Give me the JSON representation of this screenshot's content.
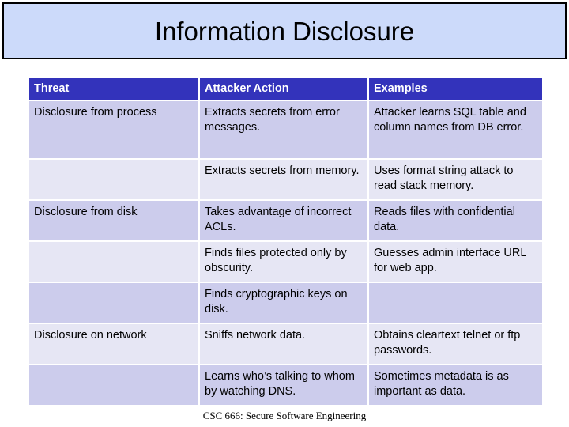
{
  "slide": {
    "title": "Information Disclosure",
    "footer": "CSC 666: Secure Software Engineering"
  },
  "colors": {
    "title_banner_bg": "#ccdafa",
    "title_banner_border": "#000000",
    "table_header_bg": "#3333bb",
    "table_header_text": "#ffffff",
    "row_shade_dark": "#ccccec",
    "row_shade_light": "#e6e6f4",
    "body_text": "#000000",
    "slide_bg": "#ffffff"
  },
  "table": {
    "headers": [
      "Threat",
      "Attacker Action",
      "Examples"
    ],
    "rows": [
      {
        "shade": "dark",
        "threat": "Disclosure from process",
        "action": "Extracts secrets from error messages.",
        "example": "Attacker learns SQL table and column names from DB error."
      },
      {
        "shade": "light",
        "threat": "",
        "action": "Extracts secrets from memory.",
        "example": "Uses format string attack to read stack memory."
      },
      {
        "shade": "dark",
        "threat": "Disclosure from disk",
        "action": "Takes advantage of incorrect ACLs.",
        "example": "Reads files with confidential data."
      },
      {
        "shade": "light",
        "threat": "",
        "action": "Finds files protected only by obscurity.",
        "example": "Guesses admin interface URL for web app."
      },
      {
        "shade": "dark",
        "threat": "",
        "action": "Finds cryptographic keys on disk.",
        "example": ""
      },
      {
        "shade": "light",
        "threat": "Disclosure on network",
        "action": "Sniffs network data.",
        "example": "Obtains cleartext telnet or ftp passwords."
      },
      {
        "shade": "dark",
        "threat": "",
        "action": "Learns who’s talking to whom by watching DNS.",
        "example": "Sometimes metadata is as important as data."
      }
    ]
  }
}
